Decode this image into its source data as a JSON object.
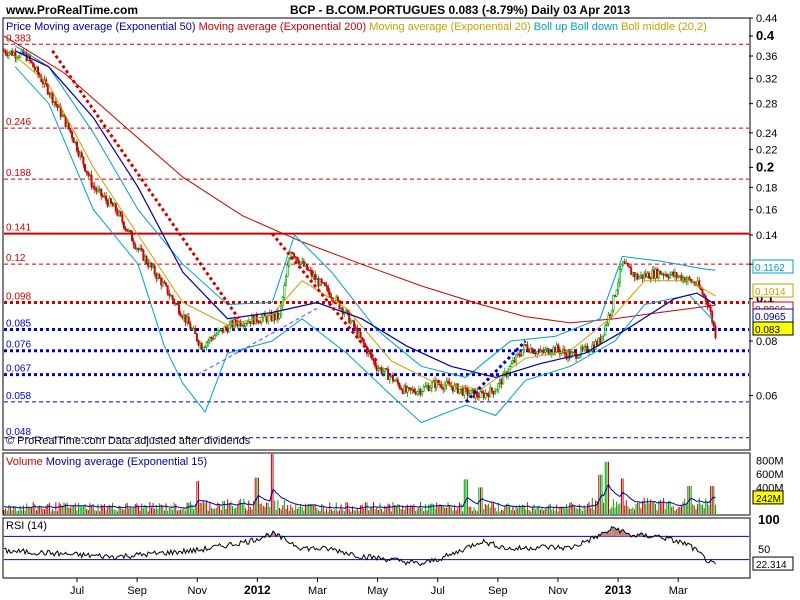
{
  "header": {
    "site": "www.ProRealTime.com",
    "title": "BCP - B.COM.PORTUGUES   0.083 (-8.79%)   Daily  03 Apr 2013"
  },
  "price_panel": {
    "legend": [
      {
        "text": "Price",
        "color": "#000080"
      },
      {
        "text": "Moving average (Exponential 50)",
        "color": "#0000a0"
      },
      {
        "text": "Moving average (Exponential 200)",
        "color": "#cc0000"
      },
      {
        "text": "Moving average (Exponential 20)",
        "color": "#c8a000"
      },
      {
        "text": "Boll up Boll down",
        "color": "#00a0c8"
      },
      {
        "text": "Boll middle (20,2)",
        "color": "#c8a000"
      }
    ],
    "note": "© ProRealTime.com  Data adjusted after dividends",
    "level_labels": [
      "0.383",
      "0.246",
      "0.188",
      "0.141",
      "0.12",
      "0.098",
      "0.085",
      "0.076",
      "0.067",
      "0.058",
      "0.048"
    ],
    "end_boxes": [
      {
        "label": "0.1162",
        "color": "#00a0c8",
        "bg": "#ffffff"
      },
      {
        "label": "0.1014",
        "color": "#c8a000",
        "bg": "#ffffff"
      },
      {
        "label": "0.0966",
        "color": "#cc0000",
        "bg": "#ffffff"
      },
      {
        "label": "0.0965",
        "color": "#0000a0",
        "bg": "#ffffff"
      },
      {
        "label": "0.083",
        "color": "#000000",
        "bg": "#ffff00"
      }
    ]
  },
  "volume_panel": {
    "legend": [
      {
        "text": "Volume",
        "color": "#cc0000"
      },
      {
        "text": "Moving average (Exponential 15)",
        "color": "#0000a0"
      }
    ],
    "ticks": [
      "800M",
      "600M",
      "400M",
      "200M"
    ],
    "box": "242M"
  },
  "rsi_panel": {
    "legend": "RSI (14)",
    "ticks": [
      "100",
      "50"
    ],
    "box": "22.314"
  },
  "x_axis": {
    "labels": [
      "Jul",
      "Sep",
      "Nov",
      "2012",
      "Mar",
      "May",
      "Jul",
      "Sep",
      "Nov",
      "2013",
      "Mar"
    ],
    "bold": [
      "2012",
      "2013"
    ]
  },
  "chart_data": {
    "type": "candlestick",
    "y_scale": "log",
    "ylim": [
      0.045,
      0.44
    ],
    "y_ticks": [
      "0.44",
      "0.4",
      "0.36",
      "0.32",
      "0.28",
      "0.24",
      "0.22",
      "0.2",
      "0.18",
      "0.16",
      "0.14",
      "0.12",
      "0.1",
      "0.08",
      "0.06"
    ],
    "y_ticks_bold": [
      "0.4",
      "0.2",
      "0.1"
    ],
    "horizontal_levels": [
      {
        "value": 0.383,
        "color": "#cc0000",
        "style": "dashed"
      },
      {
        "value": 0.246,
        "color": "#cc0000",
        "style": "dashed"
      },
      {
        "value": 0.188,
        "color": "#cc0000",
        "style": "dashed"
      },
      {
        "value": 0.141,
        "color": "#cc0000",
        "style": "solid"
      },
      {
        "value": 0.12,
        "color": "#cc0000",
        "style": "dashed"
      },
      {
        "value": 0.098,
        "color": "#cc0000",
        "style": "dotted-heavy"
      },
      {
        "value": 0.085,
        "color": "#0000cc",
        "style": "dotted-heavy"
      },
      {
        "value": 0.076,
        "color": "#0000cc",
        "style": "dotted-heavy"
      },
      {
        "value": 0.067,
        "color": "#0000cc",
        "style": "dotted-heavy"
      },
      {
        "value": 0.058,
        "color": "#0000cc",
        "style": "dashed"
      },
      {
        "value": 0.048,
        "color": "#0000cc",
        "style": "dashed"
      }
    ],
    "price_keypoints": [
      [
        0,
        0.37
      ],
      [
        0.03,
        0.36
      ],
      [
        0.06,
        0.3
      ],
      [
        0.09,
        0.24
      ],
      [
        0.12,
        0.18
      ],
      [
        0.15,
        0.16
      ],
      [
        0.18,
        0.13
      ],
      [
        0.21,
        0.11
      ],
      [
        0.24,
        0.092
      ],
      [
        0.265,
        0.078
      ],
      [
        0.285,
        0.083
      ],
      [
        0.31,
        0.088
      ],
      [
        0.34,
        0.09
      ],
      [
        0.37,
        0.091
      ],
      [
        0.385,
        0.13
      ],
      [
        0.4,
        0.12
      ],
      [
        0.42,
        0.11
      ],
      [
        0.44,
        0.102
      ],
      [
        0.46,
        0.092
      ],
      [
        0.48,
        0.08
      ],
      [
        0.5,
        0.07
      ],
      [
        0.52,
        0.066
      ],
      [
        0.54,
        0.061
      ],
      [
        0.56,
        0.062
      ],
      [
        0.58,
        0.064
      ],
      [
        0.6,
        0.063
      ],
      [
        0.62,
        0.061
      ],
      [
        0.64,
        0.06
      ],
      [
        0.66,
        0.062
      ],
      [
        0.68,
        0.07
      ],
      [
        0.7,
        0.078
      ],
      [
        0.72,
        0.075
      ],
      [
        0.74,
        0.077
      ],
      [
        0.76,
        0.074
      ],
      [
        0.78,
        0.076
      ],
      [
        0.8,
        0.08
      ],
      [
        0.815,
        0.095
      ],
      [
        0.83,
        0.12
      ],
      [
        0.85,
        0.112
      ],
      [
        0.88,
        0.115
      ],
      [
        0.91,
        0.112
      ],
      [
        0.93,
        0.108
      ],
      [
        0.945,
        0.098
      ],
      [
        0.955,
        0.083
      ]
    ],
    "ema50": [
      [
        0.015,
        0.37
      ],
      [
        0.06,
        0.34
      ],
      [
        0.12,
        0.26
      ],
      [
        0.18,
        0.18
      ],
      [
        0.24,
        0.115
      ],
      [
        0.3,
        0.09
      ],
      [
        0.36,
        0.093
      ],
      [
        0.42,
        0.098
      ],
      [
        0.48,
        0.09
      ],
      [
        0.54,
        0.078
      ],
      [
        0.6,
        0.07
      ],
      [
        0.66,
        0.066
      ],
      [
        0.72,
        0.071
      ],
      [
        0.78,
        0.075
      ],
      [
        0.84,
        0.086
      ],
      [
        0.9,
        0.1
      ],
      [
        0.93,
        0.103
      ],
      [
        0.955,
        0.097
      ]
    ],
    "ema200": [
      [
        0.0,
        0.4
      ],
      [
        0.08,
        0.33
      ],
      [
        0.16,
        0.25
      ],
      [
        0.24,
        0.19
      ],
      [
        0.32,
        0.155
      ],
      [
        0.4,
        0.135
      ],
      [
        0.48,
        0.12
      ],
      [
        0.56,
        0.107
      ],
      [
        0.64,
        0.097
      ],
      [
        0.7,
        0.091
      ],
      [
        0.76,
        0.088
      ],
      [
        0.82,
        0.09
      ],
      [
        0.88,
        0.093
      ],
      [
        0.955,
        0.0966
      ]
    ],
    "ema20": [
      [
        0.015,
        0.36
      ],
      [
        0.06,
        0.31
      ],
      [
        0.12,
        0.2
      ],
      [
        0.18,
        0.14
      ],
      [
        0.24,
        0.098
      ],
      [
        0.3,
        0.087
      ],
      [
        0.36,
        0.092
      ],
      [
        0.4,
        0.11
      ],
      [
        0.46,
        0.095
      ],
      [
        0.52,
        0.072
      ],
      [
        0.58,
        0.064
      ],
      [
        0.64,
        0.062
      ],
      [
        0.7,
        0.073
      ],
      [
        0.76,
        0.076
      ],
      [
        0.82,
        0.092
      ],
      [
        0.86,
        0.11
      ],
      [
        0.92,
        0.11
      ],
      [
        0.955,
        0.1014
      ]
    ],
    "boll_up": [
      [
        0.015,
        0.38
      ],
      [
        0.06,
        0.34
      ],
      [
        0.12,
        0.24
      ],
      [
        0.18,
        0.16
      ],
      [
        0.24,
        0.12
      ],
      [
        0.3,
        0.097
      ],
      [
        0.36,
        0.098
      ],
      [
        0.39,
        0.14
      ],
      [
        0.44,
        0.115
      ],
      [
        0.5,
        0.085
      ],
      [
        0.56,
        0.07
      ],
      [
        0.62,
        0.066
      ],
      [
        0.68,
        0.08
      ],
      [
        0.74,
        0.082
      ],
      [
        0.8,
        0.09
      ],
      [
        0.83,
        0.125
      ],
      [
        0.88,
        0.122
      ],
      [
        0.94,
        0.117
      ],
      [
        0.955,
        0.1162
      ]
    ],
    "boll_down": [
      [
        0.015,
        0.34
      ],
      [
        0.06,
        0.28
      ],
      [
        0.12,
        0.16
      ],
      [
        0.18,
        0.12
      ],
      [
        0.215,
        0.078
      ],
      [
        0.24,
        0.064
      ],
      [
        0.27,
        0.055
      ],
      [
        0.3,
        0.075
      ],
      [
        0.36,
        0.08
      ],
      [
        0.4,
        0.09
      ],
      [
        0.46,
        0.075
      ],
      [
        0.52,
        0.06
      ],
      [
        0.56,
        0.052
      ],
      [
        0.62,
        0.057
      ],
      [
        0.66,
        0.054
      ],
      [
        0.7,
        0.065
      ],
      [
        0.76,
        0.07
      ],
      [
        0.82,
        0.08
      ],
      [
        0.86,
        0.097
      ],
      [
        0.92,
        0.102
      ],
      [
        0.955,
        0.088
      ]
    ],
    "trendlines": [
      {
        "from": [
          0.065,
          0.37
        ],
        "to": [
          0.315,
          0.09
        ],
        "color": "#cc0000",
        "style": "dotted-heavy"
      },
      {
        "from": [
          0.36,
          0.141
        ],
        "to": [
          0.5,
          0.072
        ],
        "color": "#cc0000",
        "style": "dotted-heavy"
      },
      {
        "from": [
          0.26,
          0.067
        ],
        "to": [
          0.42,
          0.095
        ],
        "color": "#6666ff",
        "style": "dashed"
      },
      {
        "from": [
          0.62,
          0.058
        ],
        "to": [
          0.7,
          0.08
        ],
        "color": "#0000cc",
        "style": "dotted-heavy"
      }
    ],
    "volume": {
      "ylim": [
        0,
        900
      ],
      "unit": "M",
      "spikes": [
        [
          0.26,
          380
        ],
        [
          0.34,
          420
        ],
        [
          0.36,
          730
        ],
        [
          0.62,
          520
        ],
        [
          0.64,
          400
        ],
        [
          0.8,
          420
        ],
        [
          0.81,
          560
        ],
        [
          0.83,
          380
        ],
        [
          0.92,
          300
        ],
        [
          0.95,
          300
        ]
      ],
      "base_level": 120,
      "ema15_end": 242
    },
    "rsi": {
      "ylim": [
        0,
        100
      ],
      "levels": [
        70,
        30
      ],
      "keypoints": [
        [
          0,
          45
        ],
        [
          0.05,
          42
        ],
        [
          0.1,
          38
        ],
        [
          0.15,
          35
        ],
        [
          0.2,
          40
        ],
        [
          0.26,
          46
        ],
        [
          0.3,
          55
        ],
        [
          0.33,
          62
        ],
        [
          0.36,
          75
        ],
        [
          0.4,
          50
        ],
        [
          0.44,
          48
        ],
        [
          0.48,
          36
        ],
        [
          0.52,
          30
        ],
        [
          0.56,
          22
        ],
        [
          0.6,
          38
        ],
        [
          0.64,
          62
        ],
        [
          0.68,
          48
        ],
        [
          0.72,
          52
        ],
        [
          0.76,
          50
        ],
        [
          0.8,
          72
        ],
        [
          0.82,
          85
        ],
        [
          0.84,
          72
        ],
        [
          0.88,
          70
        ],
        [
          0.92,
          55
        ],
        [
          0.95,
          22.314
        ]
      ],
      "last": 22.314
    }
  }
}
